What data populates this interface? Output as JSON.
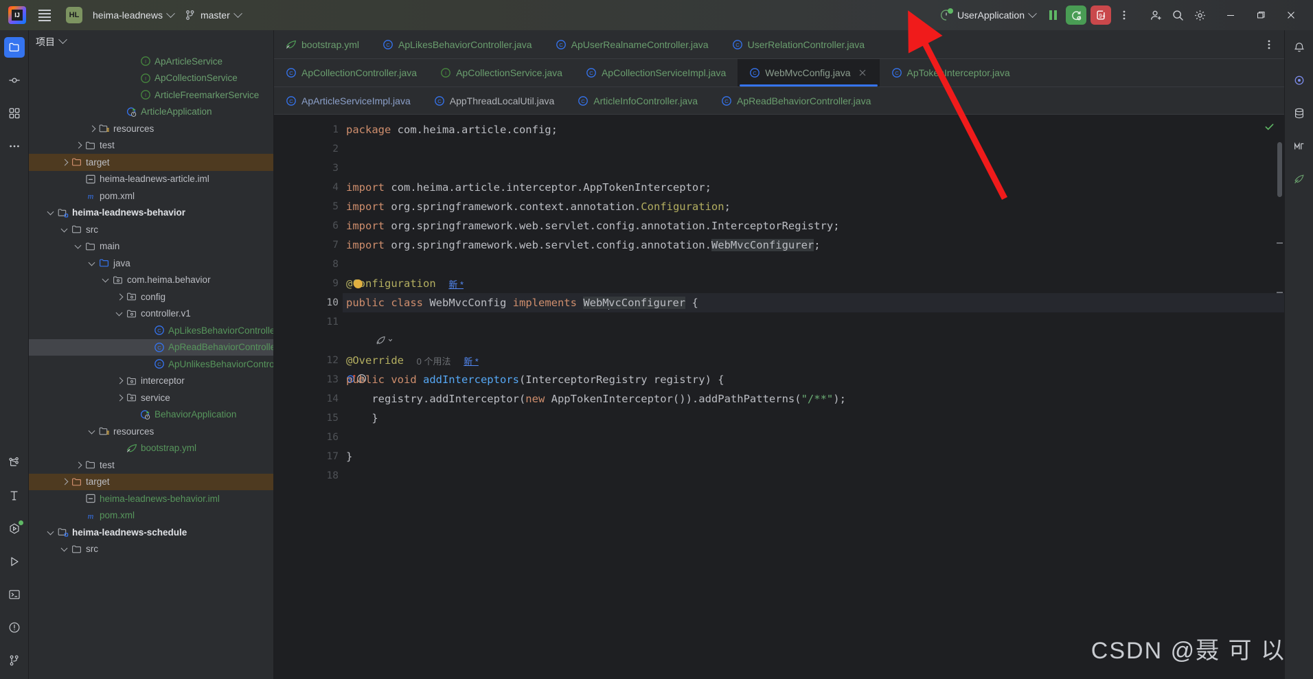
{
  "titlebar": {
    "menu_icon": "hamburger-icon",
    "project_badge": "HL",
    "project_name": "heima-leadnews",
    "branch_icon": "git-branch-icon",
    "branch_name": "master",
    "run_config": "UserApplication",
    "pause_label": "pause-icon",
    "rerun_label": "rerun-with-settings-icon",
    "stop_count": "9+",
    "more_label": "more-options-icon",
    "account_label": "account-icon",
    "search_label": "search-icon",
    "settings_label": "settings-icon",
    "minimize": "minimize-icon",
    "maximize": "maximize-icon",
    "close": "close-icon"
  },
  "left_rail": [
    {
      "name": "project-tool-icon",
      "active": true
    },
    {
      "name": "commit-tool-icon",
      "active": false
    },
    {
      "name": "structure-tool-icon",
      "active": false
    },
    {
      "name": "more-tool-windows-icon",
      "active": false
    },
    {
      "name": "services-icon",
      "active": false
    },
    {
      "name": "build-icon",
      "active": false
    },
    {
      "name": "run-dashboard-icon",
      "active": false,
      "badge": true
    },
    {
      "name": "run-icon",
      "active": false
    },
    {
      "name": "terminal-icon",
      "active": false
    },
    {
      "name": "problems-icon",
      "active": false
    },
    {
      "name": "version-control-icon",
      "active": false
    }
  ],
  "right_rail": [
    {
      "name": "notifications-icon"
    },
    {
      "name": "ai-assistant-icon"
    },
    {
      "name": "database-icon"
    },
    {
      "name": "maven-icon"
    },
    {
      "name": "bean-validation-icon"
    }
  ],
  "project_panel": {
    "title": "项目",
    "tree": [
      {
        "indent": 7,
        "arrow": "none",
        "icon": "interface-icon",
        "label": "ApArticleService",
        "color": "c-lgreen"
      },
      {
        "indent": 7,
        "arrow": "none",
        "icon": "interface-icon",
        "label": "ApCollectionService",
        "color": "c-lgreen"
      },
      {
        "indent": 7,
        "arrow": "none",
        "icon": "interface-icon",
        "label": "ArticleFreemarkerService",
        "color": "c-lgreen"
      },
      {
        "indent": 6,
        "arrow": "none",
        "icon": "spring-run-icon",
        "label": "ArticleApplication",
        "color": "c-lgreen"
      },
      {
        "indent": 4,
        "arrow": "right",
        "icon": "resources-folder-icon",
        "label": "resources",
        "color": "c-def"
      },
      {
        "indent": 3,
        "arrow": "right",
        "icon": "folder-icon",
        "label": "test",
        "color": "c-def"
      },
      {
        "indent": 2,
        "arrow": "right",
        "icon": "target-folder-icon",
        "label": "target",
        "color": "c-def",
        "state": "target"
      },
      {
        "indent": 3,
        "arrow": "none",
        "icon": "iml-file-icon",
        "label": "heima-leadnews-article.iml",
        "color": "c-def"
      },
      {
        "indent": 3,
        "arrow": "none",
        "icon": "maven-m-icon",
        "label": "pom.xml",
        "color": "c-def"
      },
      {
        "indent": 1,
        "arrow": "down",
        "icon": "module-icon",
        "label": "heima-leadnews-behavior",
        "color": "c-white",
        "bold": true
      },
      {
        "indent": 2,
        "arrow": "down",
        "icon": "folder-icon",
        "label": "src",
        "color": "c-def"
      },
      {
        "indent": 3,
        "arrow": "down",
        "icon": "folder-icon",
        "label": "main",
        "color": "c-def"
      },
      {
        "indent": 4,
        "arrow": "down",
        "icon": "source-folder-icon",
        "label": "java",
        "color": "c-def"
      },
      {
        "indent": 5,
        "arrow": "down",
        "icon": "package-icon",
        "label": "com.heima.behavior",
        "color": "c-def"
      },
      {
        "indent": 6,
        "arrow": "right",
        "icon": "package-icon",
        "label": "config",
        "color": "c-def"
      },
      {
        "indent": 6,
        "arrow": "down",
        "icon": "package-icon",
        "label": "controller.v1",
        "color": "c-def"
      },
      {
        "indent": 8,
        "arrow": "none",
        "icon": "class-icon",
        "label": "ApLikesBehaviorController",
        "color": "c-green"
      },
      {
        "indent": 8,
        "arrow": "none",
        "icon": "class-icon",
        "label": "ApReadBehaviorController",
        "color": "c-green",
        "state": "selected"
      },
      {
        "indent": 8,
        "arrow": "none",
        "icon": "class-icon",
        "label": "ApUnlikesBehaviorController",
        "color": "c-green"
      },
      {
        "indent": 6,
        "arrow": "right",
        "icon": "package-icon",
        "label": "interceptor",
        "color": "c-def"
      },
      {
        "indent": 6,
        "arrow": "right",
        "icon": "package-icon",
        "label": "service",
        "color": "c-def"
      },
      {
        "indent": 7,
        "arrow": "none",
        "icon": "spring-run-icon",
        "label": "BehaviorApplication",
        "color": "c-green"
      },
      {
        "indent": 4,
        "arrow": "down",
        "icon": "resources-folder-icon",
        "label": "resources",
        "color": "c-def"
      },
      {
        "indent": 6,
        "arrow": "none",
        "icon": "yaml-icon",
        "label": "bootstrap.yml",
        "color": "c-green"
      },
      {
        "indent": 3,
        "arrow": "right",
        "icon": "folder-icon",
        "label": "test",
        "color": "c-def"
      },
      {
        "indent": 2,
        "arrow": "right",
        "icon": "target-folder-icon",
        "label": "target",
        "color": "c-def",
        "state": "target"
      },
      {
        "indent": 3,
        "arrow": "none",
        "icon": "iml-file-icon",
        "label": "heima-leadnews-behavior.iml",
        "color": "c-green"
      },
      {
        "indent": 3,
        "arrow": "none",
        "icon": "maven-m-icon",
        "label": "pom.xml",
        "color": "c-green"
      },
      {
        "indent": 1,
        "arrow": "down",
        "icon": "module-icon",
        "label": "heima-leadnews-schedule",
        "color": "c-white",
        "bold": true
      },
      {
        "indent": 2,
        "arrow": "down",
        "icon": "folder-icon",
        "label": "src",
        "color": "c-def"
      }
    ]
  },
  "editor": {
    "tab_rows": [
      [
        {
          "label": "bootstrap.yml",
          "icon": "yaml-icon",
          "color": "#6a9e6e",
          "active": false
        },
        {
          "label": "ApLikesBehaviorController.java",
          "icon": "class-icon",
          "color": "#6a9e6e",
          "active": false
        },
        {
          "label": "ApUserRealnameController.java",
          "icon": "class-icon",
          "color": "#6a9e6e",
          "active": false
        },
        {
          "label": "UserRelationController.java",
          "icon": "class-icon",
          "color": "#6a9e6e",
          "active": false
        }
      ],
      [
        {
          "label": "ApCollectionController.java",
          "icon": "class-icon",
          "color": "#6a9e6e",
          "active": false
        },
        {
          "label": "ApCollectionService.java",
          "icon": "interface-icon",
          "color": "#6a9e6e",
          "active": false
        },
        {
          "label": "ApCollectionServiceImpl.java",
          "icon": "class-icon",
          "color": "#6a9e6e",
          "active": false
        },
        {
          "label": "WebMvcConfig.java",
          "icon": "class-icon",
          "color": "#8c9e8f",
          "active": true,
          "closable": true
        },
        {
          "label": "ApTokenInterceptor.java",
          "icon": "class-icon",
          "color": "#6a9e6e",
          "active": false
        }
      ],
      [
        {
          "label": "ApArticleServiceImpl.java",
          "icon": "class-icon",
          "color": "#8ca0c9",
          "active": false
        },
        {
          "label": "AppThreadLocalUtil.java",
          "icon": "class-icon",
          "color": "#b0b3b8",
          "active": false
        },
        {
          "label": "ArticleInfoController.java",
          "icon": "class-icon",
          "color": "#6a9e6e",
          "active": false
        },
        {
          "label": "ApReadBehaviorController.java",
          "icon": "class-icon",
          "color": "#6a9e6e",
          "active": false
        }
      ]
    ],
    "code_lines": [
      {
        "n": 1,
        "tokens": [
          {
            "t": "package ",
            "c": "kw"
          },
          {
            "t": "com.heima.article.config;",
            "c": "plain"
          }
        ]
      },
      {
        "n": 2,
        "tokens": []
      },
      {
        "n": 3,
        "tokens": []
      },
      {
        "n": 4,
        "tokens": [
          {
            "t": "import ",
            "c": "kw"
          },
          {
            "t": "com.heima.article.interceptor.AppTokenInterceptor;",
            "c": "plain"
          }
        ]
      },
      {
        "n": 5,
        "tokens": [
          {
            "t": "import ",
            "c": "kw"
          },
          {
            "t": "org.springframework.context.annotation.",
            "c": "plain"
          },
          {
            "t": "Configuration",
            "c": "ann"
          },
          {
            "t": ";",
            "c": "plain"
          }
        ]
      },
      {
        "n": 6,
        "tokens": [
          {
            "t": "import ",
            "c": "kw"
          },
          {
            "t": "org.springframework.web.servlet.config.annotation.InterceptorRegistry;",
            "c": "plain"
          }
        ]
      },
      {
        "n": 7,
        "tokens": [
          {
            "t": "import ",
            "c": "kw"
          },
          {
            "t": "org.springframework.web.servlet.config.annotation.",
            "c": "plain"
          },
          {
            "t": "WebMvcConfigurer",
            "c": "ident-hl"
          },
          {
            "t": ";",
            "c": "plain"
          }
        ]
      },
      {
        "n": 8,
        "tokens": []
      },
      {
        "n": 9,
        "tokens": [
          {
            "t": "@Configuration",
            "c": "ann"
          },
          {
            "t": "  ",
            "c": "plain"
          },
          {
            "t": "新 *",
            "c": "newstar"
          }
        ],
        "bulb": true
      },
      {
        "n": 10,
        "tokens": [
          {
            "t": "public class ",
            "c": "kw"
          },
          {
            "t": "WebMvcConfig ",
            "c": "plain"
          },
          {
            "t": "implements ",
            "c": "kw"
          },
          {
            "t": "WebMvcConfigurer",
            "c": "ident-hl",
            "caret_after": 4
          },
          {
            "t": " {",
            "c": "plain"
          }
        ],
        "current": true,
        "gutter_icon": "implemented-method-icon"
      },
      {
        "n": 11,
        "tokens": []
      },
      {
        "n": null,
        "tokens": [
          {
            "t": "SPRING_BEAN_MARK",
            "c": "inlay"
          }
        ]
      },
      {
        "n": 12,
        "tokens": [
          {
            "t": "@Override",
            "c": "ann"
          },
          {
            "t": "  ",
            "c": "plain"
          },
          {
            "t": "0 个用法",
            "c": "usagehint"
          },
          {
            "t": "  ",
            "c": "plain"
          },
          {
            "t": "新 *",
            "c": "newstar"
          }
        ]
      },
      {
        "n": 13,
        "tokens": [
          {
            "t": "public void ",
            "c": "kw"
          },
          {
            "t": "addInterceptors",
            "c": "meth"
          },
          {
            "t": "(InterceptorRegistry registry) {",
            "c": "plain"
          }
        ],
        "gutter_icon": "overriding-method-icon"
      },
      {
        "n": 14,
        "tokens": [
          {
            "t": "    registry.addInterceptor(",
            "c": "plain"
          },
          {
            "t": "new ",
            "c": "kw"
          },
          {
            "t": "AppTokenInterceptor()).addPathPatterns(",
            "c": "plain"
          },
          {
            "t": "\"/**\"",
            "c": "str"
          },
          {
            "t": ");",
            "c": "plain"
          }
        ]
      },
      {
        "n": 15,
        "tokens": [
          {
            "t": "    }",
            "c": "plain"
          }
        ]
      },
      {
        "n": 16,
        "tokens": []
      },
      {
        "n": 17,
        "tokens": [
          {
            "t": "}",
            "c": "plain"
          }
        ]
      },
      {
        "n": 18,
        "tokens": []
      }
    ],
    "status_check": "inspections-ok-icon"
  },
  "annotation": {
    "arrow_color": "#f01b1b"
  },
  "watermark": "CSDN @聂 可 以",
  "colors": {
    "accent": "#3574f0",
    "green": "#499c54",
    "red": "#c9484b",
    "target_row": "#4e3a20"
  }
}
